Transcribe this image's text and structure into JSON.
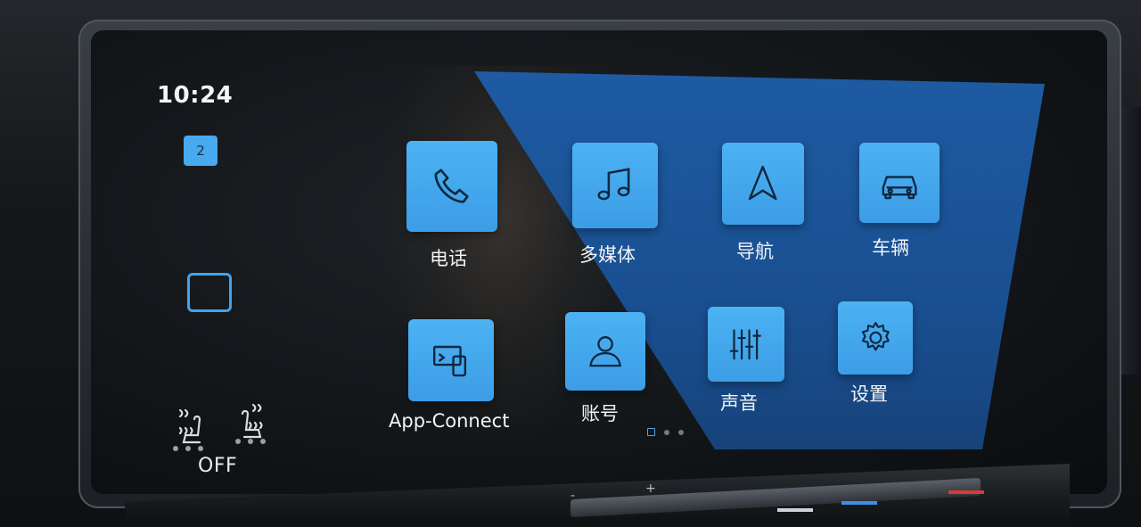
{
  "status": {
    "time": "10:24",
    "badge_count": "2"
  },
  "climate": {
    "seat_status": "OFF"
  },
  "apps": [
    {
      "label": "电话",
      "icon": "phone-icon"
    },
    {
      "label": "多媒体",
      "icon": "music-note-icon"
    },
    {
      "label": "导航",
      "icon": "navigation-arrow-icon"
    },
    {
      "label": "车辆",
      "icon": "car-icon"
    },
    {
      "label": "App-Connect",
      "icon": "app-connect-icon"
    },
    {
      "label": "账号",
      "icon": "user-account-icon"
    },
    {
      "label": "声音",
      "icon": "equalizer-icon"
    },
    {
      "label": "设置",
      "icon": "gear-icon"
    }
  ],
  "pagination": {
    "current_page": 1,
    "total_pages": 3
  },
  "colors": {
    "accent": "#47a9ee",
    "panel": "#1f5da6",
    "background": "#121518"
  }
}
